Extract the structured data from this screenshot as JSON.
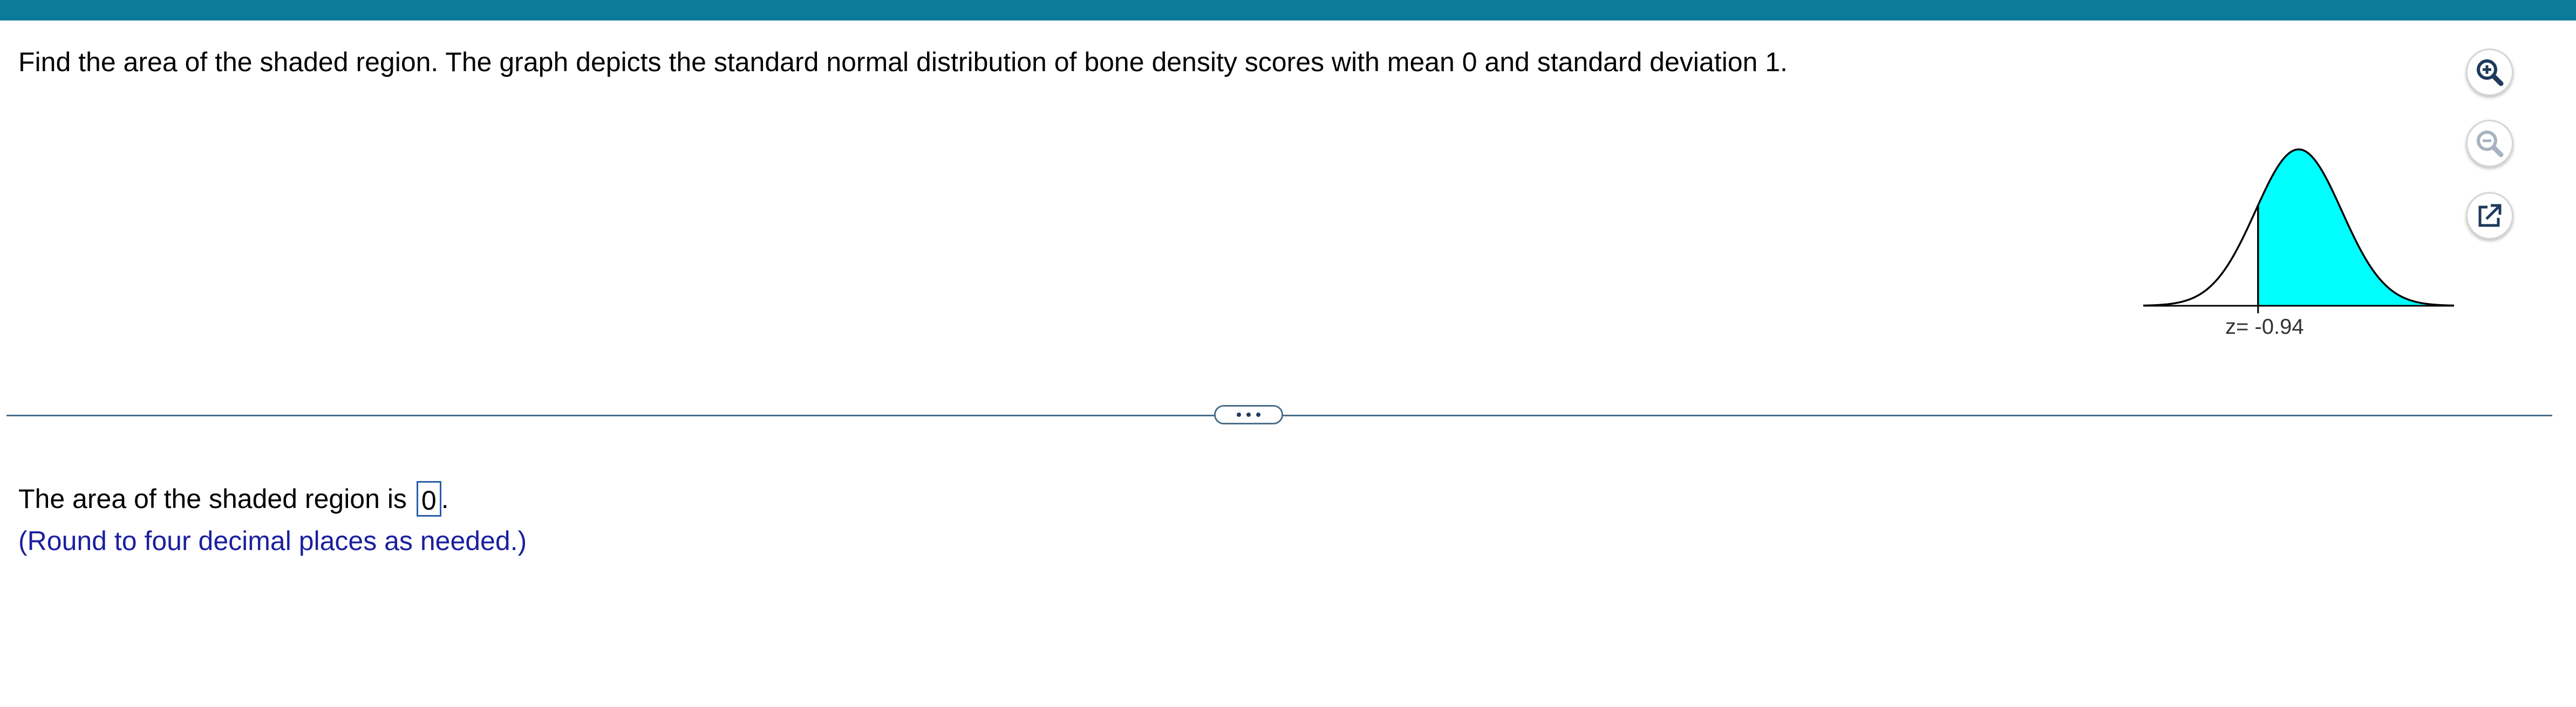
{
  "question": {
    "text": "Find the area of the shaded region. The graph depicts the standard normal distribution of bone density scores with mean 0 and standard deviation 1."
  },
  "graph": {
    "z_label": "z= -0.94",
    "z_value": -0.94,
    "shaded_side": "right",
    "fill_color": "#00ffff"
  },
  "tools": {
    "zoom_in_icon": "zoom-in-icon",
    "zoom_out_icon": "zoom-out-icon",
    "popout_icon": "external-link-icon"
  },
  "answer": {
    "prefix": "The area of the shaded region is",
    "value": "0",
    "suffix": ".",
    "hint": "(Round to four decimal places as needed.)"
  },
  "colors": {
    "top_bar": "#0c7a99",
    "hint_text": "#1a1f9e",
    "answer_box_border": "#2a5fa8"
  }
}
